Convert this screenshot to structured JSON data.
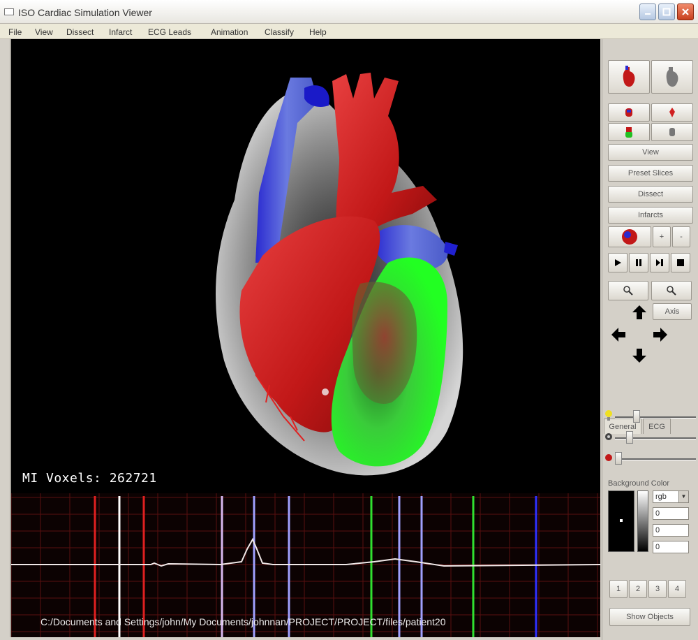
{
  "window": {
    "title": "ISO Cardiac Simulation Viewer"
  },
  "menu": [
    "File",
    "View",
    "Dissect",
    "Infarct",
    "ECG Leads",
    "Animation",
    "Classify",
    "Help"
  ],
  "viewport": {
    "mi_voxels_label": "MI Voxels: 262721"
  },
  "ecg": {
    "file_path": "C:/Documents and Settings/john/My Documents/johnnan/PROJECT/PROJECT/files/patient20",
    "marker_colors": [
      "#e02020",
      "#ffffff",
      "#e02020",
      "#d8b8f0",
      "#a0a0ff",
      "#a0a0ff",
      "#30e030",
      "#a0a0ff",
      "#a0a0ff",
      "#30e030",
      "#3030ff"
    ]
  },
  "panel": {
    "view_label": "View",
    "preset_slices_label": "Preset Slices",
    "dissect_label": "Dissect",
    "infarcts_label": "Infarcts",
    "plus_label": "+",
    "minus_label": "-",
    "axis_label": "Axis",
    "tab_general": "General",
    "tab_ecg": "ECG",
    "background_color_label": "Background Color",
    "color_mode": "rgb",
    "rgb_values": [
      "0",
      "0",
      "0"
    ],
    "page_buttons": [
      "1",
      "2",
      "3",
      "4"
    ],
    "show_objects_label": "Show Objects"
  }
}
